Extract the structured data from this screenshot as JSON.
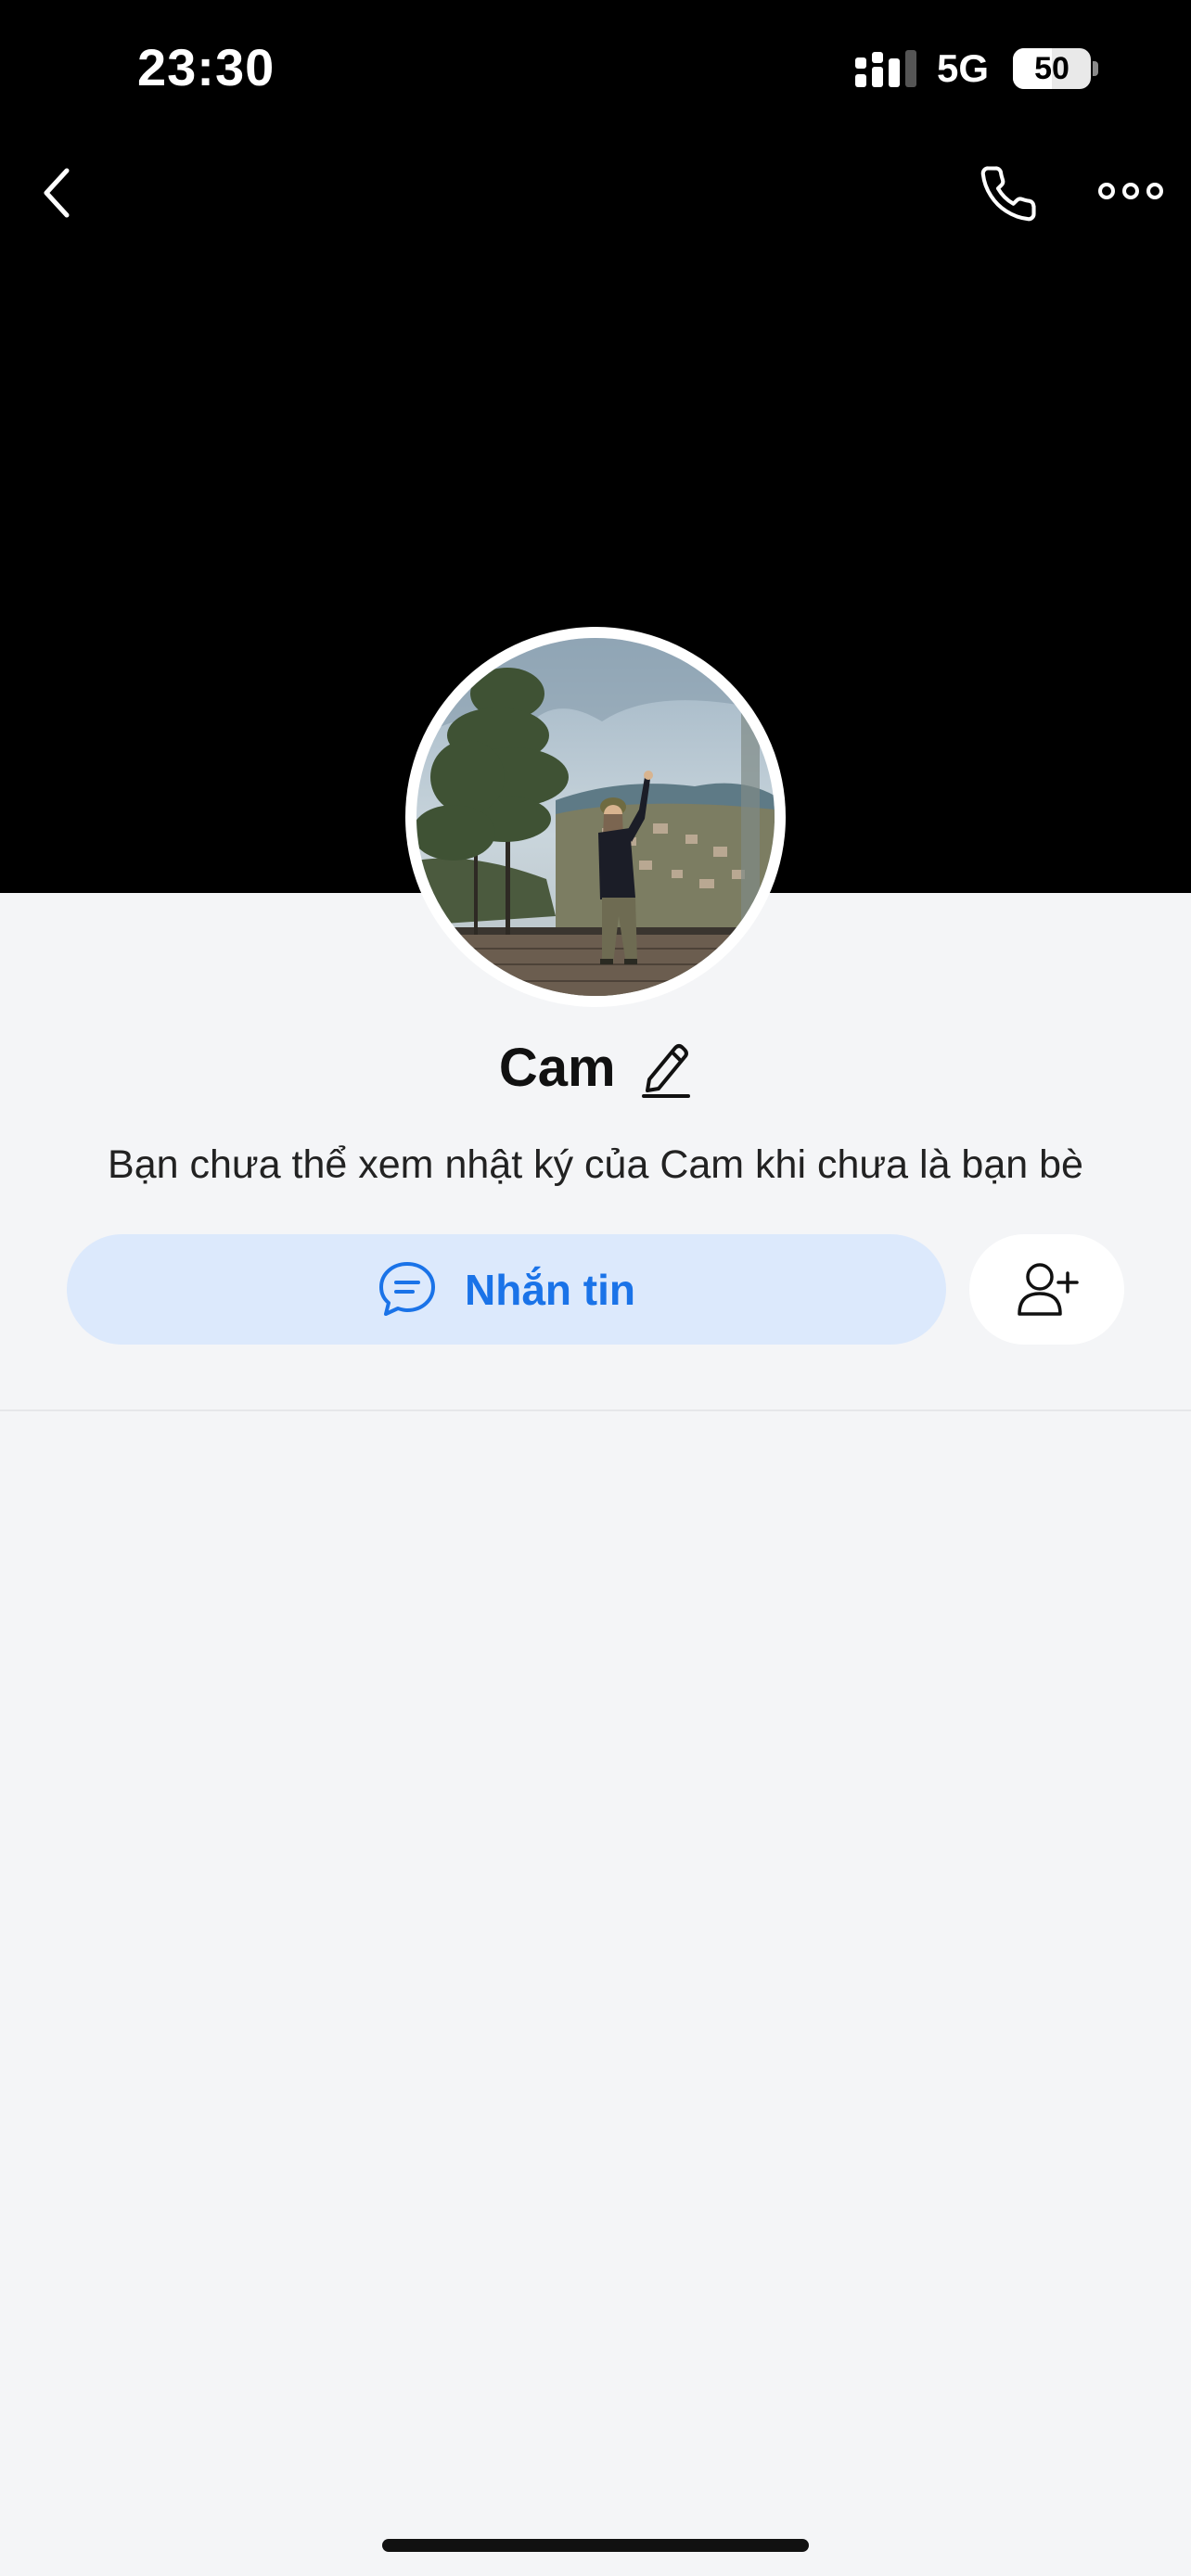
{
  "status_bar": {
    "time": "23:30",
    "network": "5G",
    "battery": "50",
    "battery_level_percent": 50
  },
  "header": {
    "back_icon": "chevron-left-icon",
    "call_icon": "phone-icon",
    "more_icon": "more-horizontal-icon"
  },
  "profile": {
    "name": "Cam",
    "edit_icon": "pencil-icon",
    "notice": "Bạn chưa thể xem nhật ký của Cam khi chưa là bạn bè"
  },
  "actions": {
    "message_label": "Nhắn tin",
    "message_icon": "chat-bubble-icon",
    "add_friend_icon": "add-user-icon"
  },
  "colors": {
    "accent": "#1a73e8",
    "message_button_bg": "#dce9fc",
    "cover_bg": "#000000",
    "page_bg": "#f4f5f7"
  }
}
